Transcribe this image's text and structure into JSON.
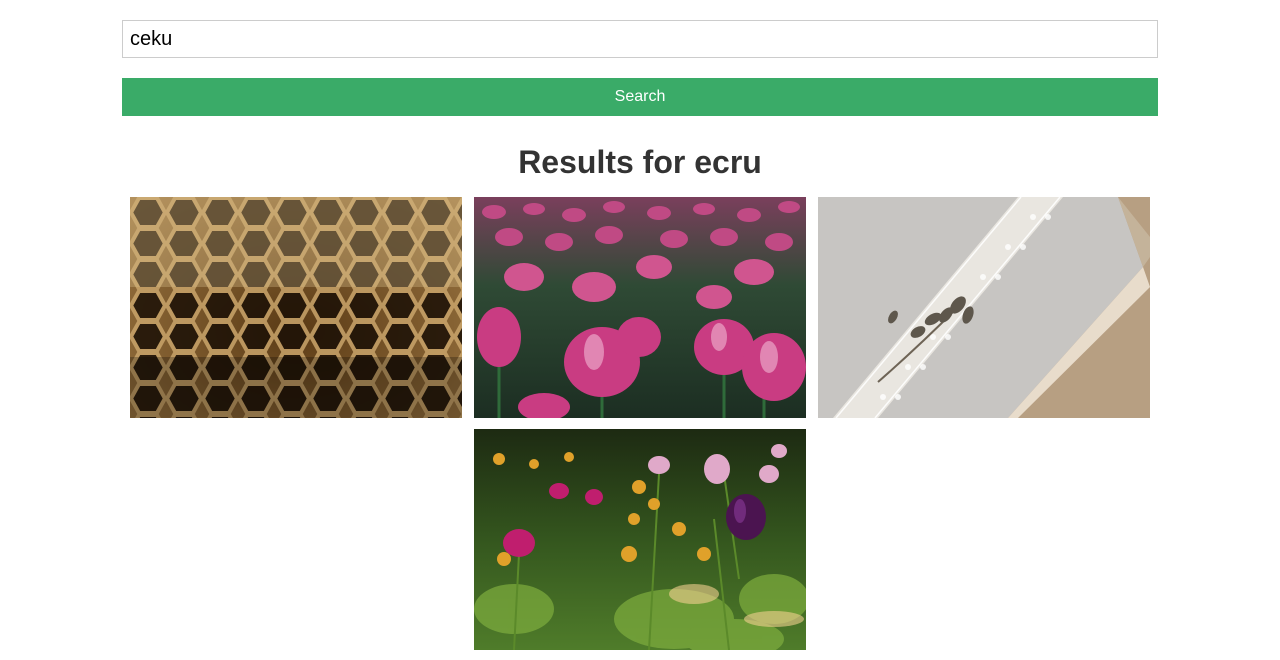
{
  "search": {
    "value": "ceku",
    "button_label": "Search"
  },
  "results": {
    "title": "Results for ecru",
    "images": [
      {
        "icon": "honeycomb-photo"
      },
      {
        "icon": "pink-tulips-photo"
      },
      {
        "icon": "linen-book-lace-photo"
      },
      {
        "icon": "wildflowers-tulips-photo"
      }
    ]
  },
  "colors": {
    "accent": "#3aab68",
    "title": "#333333",
    "input_border": "#cccccc"
  }
}
